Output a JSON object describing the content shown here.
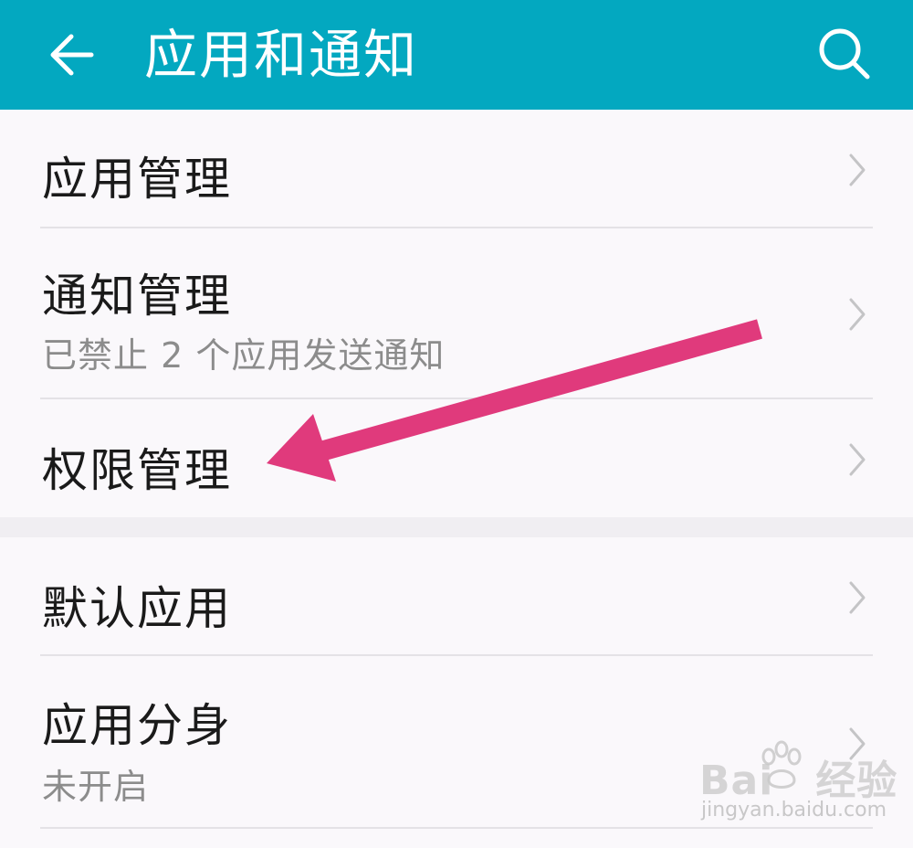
{
  "appbar": {
    "title": "应用和通知",
    "back_icon": "arrow-back-icon",
    "search_icon": "search-icon",
    "background_color": "#03a8c0"
  },
  "items": [
    {
      "title": "应用管理"
    },
    {
      "title": "通知管理",
      "subtitle": "已禁止 2 个应用发送通知"
    },
    {
      "title": "权限管理"
    },
    {
      "title": "默认应用"
    },
    {
      "title": "应用分身",
      "subtitle": "未开启"
    }
  ],
  "annotation": {
    "type": "arrow",
    "color": "#e03a7c",
    "points_to": "权限管理"
  },
  "watermark": {
    "logo": "Baidu经验",
    "url": "jingyan.baidu.com"
  }
}
